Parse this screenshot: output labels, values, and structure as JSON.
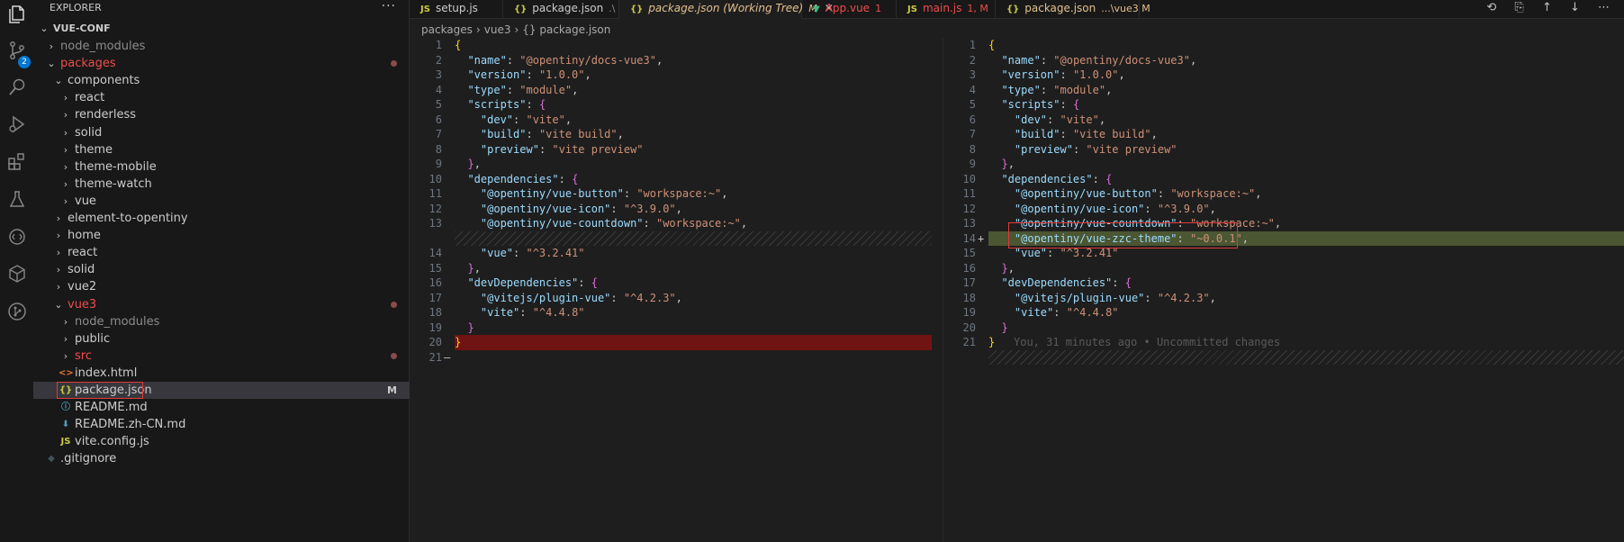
{
  "explorer": {
    "header": "EXPLORER",
    "more": "···",
    "root": "VUE-CONF",
    "items": [
      {
        "label": "node_modules",
        "kind": "folder",
        "open": false,
        "color": "#8c8c8c"
      },
      {
        "label": "packages",
        "kind": "folder",
        "open": true,
        "color": "#f14c4c"
      },
      {
        "label": "components",
        "kind": "folder",
        "open": true,
        "color": "#cccccc"
      },
      {
        "label": "react",
        "kind": "folder",
        "open": false,
        "color": "#cccccc"
      },
      {
        "label": "renderless",
        "kind": "folder",
        "open": false,
        "color": "#cccccc"
      },
      {
        "label": "solid",
        "kind": "folder",
        "open": false,
        "color": "#cccccc"
      },
      {
        "label": "theme",
        "kind": "folder",
        "open": false,
        "color": "#cccccc"
      },
      {
        "label": "theme-mobile",
        "kind": "folder",
        "open": false,
        "color": "#cccccc"
      },
      {
        "label": "theme-watch",
        "kind": "folder",
        "open": false,
        "color": "#cccccc"
      },
      {
        "label": "vue",
        "kind": "folder",
        "open": false,
        "color": "#cccccc"
      },
      {
        "label": "element-to-opentiny",
        "kind": "folder",
        "open": false,
        "color": "#cccccc"
      },
      {
        "label": "home",
        "kind": "folder",
        "open": false,
        "color": "#cccccc"
      },
      {
        "label": "react",
        "kind": "folder",
        "open": false,
        "color": "#cccccc"
      },
      {
        "label": "solid",
        "kind": "folder",
        "open": false,
        "color": "#cccccc"
      },
      {
        "label": "vue2",
        "kind": "folder",
        "open": false,
        "color": "#cccccc"
      },
      {
        "label": "vue3",
        "kind": "folder",
        "open": true,
        "color": "#f14c4c"
      },
      {
        "label": "node_modules",
        "kind": "folder",
        "open": false,
        "color": "#8c8c8c"
      },
      {
        "label": "public",
        "kind": "folder",
        "open": false,
        "color": "#cccccc"
      },
      {
        "label": "src",
        "kind": "folder",
        "open": false,
        "color": "#f14c4c"
      },
      {
        "label": "index.html",
        "kind": "file",
        "icon": "<>",
        "iconColor": "#e37933",
        "color": "#cccccc"
      },
      {
        "label": "package.json",
        "kind": "file",
        "icon": "{}",
        "iconColor": "#cbcb41",
        "color": "#cccccc",
        "flag": "M"
      },
      {
        "label": "README.md",
        "kind": "file",
        "icon": "ⓘ",
        "iconColor": "#519aba",
        "color": "#cccccc"
      },
      {
        "label": "README.zh-CN.md",
        "kind": "file",
        "icon": "⬇",
        "iconColor": "#519aba",
        "color": "#cccccc"
      },
      {
        "label": "vite.config.js",
        "kind": "file",
        "icon": "JS",
        "iconColor": "#cbcb41",
        "color": "#cccccc"
      },
      {
        "label": ".gitignore",
        "kind": "file",
        "icon": "◆",
        "iconColor": "#41535b",
        "color": "#cccccc"
      }
    ]
  },
  "activity": {
    "scm_badge": "2"
  },
  "tabs": [
    {
      "icon": "JS",
      "label": "setup.js",
      "suffix": "",
      "color": "#cccccc"
    },
    {
      "icon": "{}",
      "label": "package.json",
      "suffix": ".\\",
      "color": "#cccccc"
    },
    {
      "icon": "{}",
      "label": "package.json (Working Tree)",
      "suffix": "M",
      "color": "#e2c08d",
      "active": true
    },
    {
      "icon": "▼",
      "label": "App.vue",
      "suffix": "1",
      "color": "#f14c4c"
    },
    {
      "icon": "JS",
      "label": "main.js",
      "suffix": "1, M",
      "color": "#f14c4c"
    },
    {
      "icon": "{}",
      "label": "package.json",
      "suffix": "...\\vue3  M",
      "color": "#e2c08d"
    }
  ],
  "toolbar_glyphs": "⟲ ⎘ ↑ ↓ ⋯",
  "breadcrumb": [
    "packages",
    "vue3",
    "{} package.json"
  ],
  "left_lines": [
    "1",
    "2",
    "3",
    "4",
    "5",
    "6",
    "7",
    "8",
    "9",
    "10",
    "11",
    "12",
    "13",
    "14",
    "15",
    "16",
    "17",
    "18",
    "19",
    "20",
    "21"
  ],
  "right_lines": [
    "1",
    "2",
    "3",
    "4",
    "5",
    "6",
    "7",
    "8",
    "9",
    "10",
    "11",
    "12",
    "13",
    "14",
    "15",
    "16",
    "17",
    "18",
    "19",
    "20",
    "21"
  ],
  "code": {
    "name_key": "\"name\"",
    "name_val": "\"@opentiny/docs-vue3\"",
    "version_key": "\"version\"",
    "version_val": "\"1.0.0\"",
    "type_key": "\"type\"",
    "type_val": "\"module\"",
    "scripts_key": "\"scripts\"",
    "dev_key": "\"dev\"",
    "dev_val": "\"vite\"",
    "build_key": "\"build\"",
    "build_val": "\"vite build\"",
    "preview_key": "\"preview\"",
    "preview_val": "\"vite preview\"",
    "deps_key": "\"dependencies\"",
    "btn_key": "\"@opentiny/vue-button\"",
    "btn_val": "\"workspace:~\"",
    "icon_key": "\"@opentiny/vue-icon\"",
    "icon_val": "\"^3.9.0\"",
    "cd_key": "\"@opentiny/vue-countdown\"",
    "cd_val": "\"workspace:~\"",
    "theme_key": "\"@opentiny/vue-zzc-theme\"",
    "theme_val": "\"~0.0.1\"",
    "vue_key": "\"vue\"",
    "vue_val": "\"^3.2.41\"",
    "devdeps_key": "\"devDependencies\"",
    "plugin_key": "\"@vitejs/plugin-vue\"",
    "plugin_val": "\"^4.2.3\"",
    "vite_key": "\"vite\"",
    "vite_val": "\"^4.4.8\""
  },
  "blame": "You, 31 minutes ago • Uncommitted changes"
}
